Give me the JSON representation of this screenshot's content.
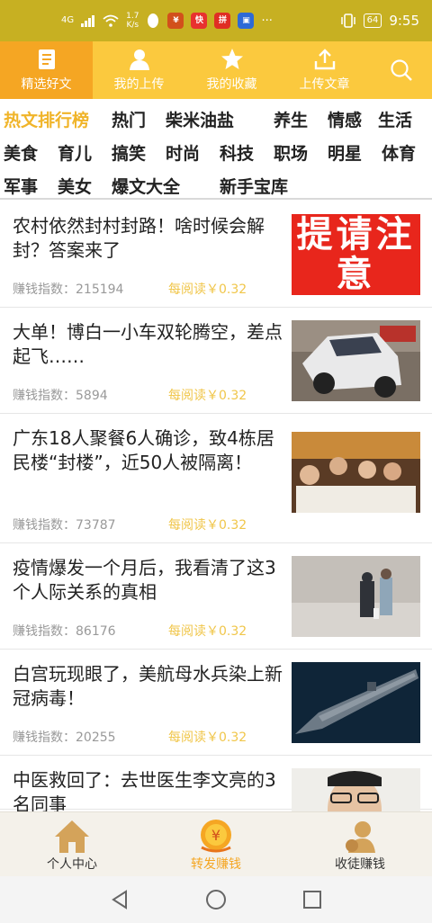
{
  "status_bar": {
    "signal": "4G",
    "speed_value": "1.7",
    "speed_unit": "K/s",
    "battery": "64",
    "time": "9:55",
    "more": "···",
    "app_icon_1": "快",
    "app_icon_2": "拼"
  },
  "top_nav": {
    "tabs": [
      {
        "label": "精选好文",
        "icon": "document-icon"
      },
      {
        "label": "我的上传",
        "icon": "person-icon"
      },
      {
        "label": "我的收藏",
        "icon": "star-icon"
      },
      {
        "label": "上传文章",
        "icon": "upload-icon"
      }
    ],
    "search_icon": "search-icon"
  },
  "categories": {
    "row1": [
      "热文排行榜",
      "热门",
      "柴米油盐",
      "养生",
      "情感",
      "生活"
    ],
    "row2": [
      "美食",
      "育儿",
      "搞笑",
      "时尚",
      "科技",
      "职场",
      "明星",
      "体育"
    ],
    "row3": [
      "军事",
      "美女",
      "爆文大全",
      "新手宝库"
    ]
  },
  "articles": [
    {
      "title": "农村依然封村封路！啥时候会解封？答案来了",
      "meta": "赚钱指数：215194",
      "reward": "每阅读￥0.32",
      "thumb_text": "提请注意"
    },
    {
      "title": "大单！博白一小车双轮腾空，差点起飞……",
      "meta": "赚钱指数：5894",
      "reward": "每阅读￥0.32"
    },
    {
      "title": "广东18人聚餐6人确诊，致4栋居民楼“封楼”，近50人被隔离！",
      "meta": "赚钱指数：73787",
      "reward": "每阅读￥0.32"
    },
    {
      "title": "疫情爆发一个月后，我看清了这3个人际关系的真相",
      "meta": "赚钱指数：86176",
      "reward": "每阅读￥0.32"
    },
    {
      "title": "白宫玩现眼了，美航母水兵染上新冠病毒！",
      "meta": "赚钱指数：20255",
      "reward": "每阅读￥0.32"
    },
    {
      "title": "中医救回了：去世医生李文亮的3名同事",
      "meta": "",
      "reward": ""
    }
  ],
  "bottom_tabs": [
    {
      "label": "个人中心",
      "icon": "home-icon"
    },
    {
      "label": "转发赚钱",
      "icon": "coin-medal-icon"
    },
    {
      "label": "收徒赚钱",
      "icon": "apprentice-icon"
    }
  ],
  "colors": {
    "status_bar": "#c7b022",
    "nav_bg": "#fbc93e",
    "nav_active": "#f5a623",
    "hot_category": "#f0b429",
    "reward": "#f0c64a"
  }
}
